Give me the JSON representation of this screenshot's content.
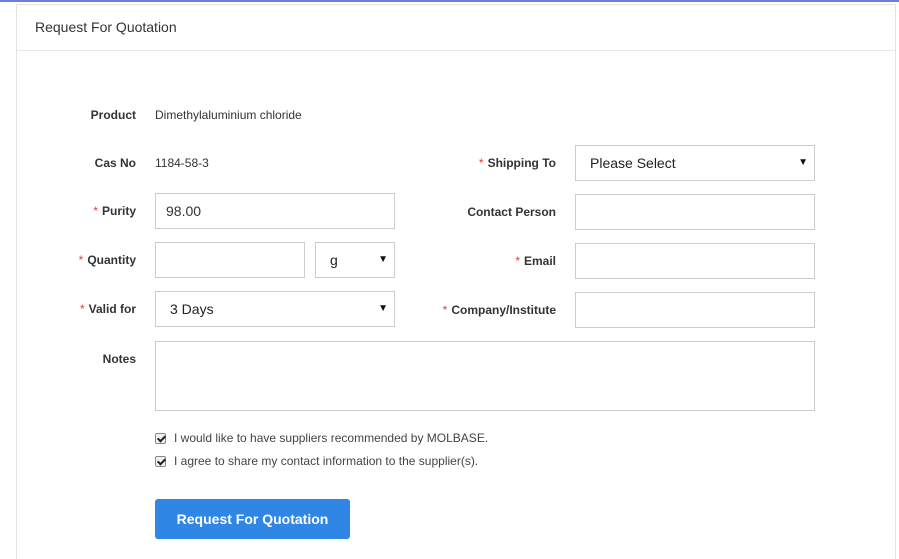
{
  "panel": {
    "title": "Request For Quotation"
  },
  "form": {
    "product": {
      "label": "Product",
      "value": "Dimethylaluminium chloride"
    },
    "cas": {
      "label": "Cas No",
      "value": "1184-58-3"
    },
    "purity": {
      "label": "Purity",
      "required": "*",
      "value": "98.00"
    },
    "quantity": {
      "label": "Quantity",
      "required": "*",
      "value": "",
      "unit": "g"
    },
    "valid_for": {
      "label": "Valid for",
      "required": "*",
      "value": "3 Days"
    },
    "notes": {
      "label": "Notes",
      "value": ""
    },
    "shipping_to": {
      "label": "Shipping To",
      "required": "*",
      "value": "Please Select"
    },
    "contact_person": {
      "label": "Contact Person",
      "value": ""
    },
    "email": {
      "label": "Email",
      "required": "*",
      "value": ""
    },
    "company": {
      "label": "Company/Institute",
      "required": "*",
      "value": ""
    }
  },
  "checkboxes": [
    {
      "label": "I would like to have suppliers recommended by MOLBASE.",
      "checked": true
    },
    {
      "label": "I agree to share my contact information to the supplier(s).",
      "checked": true
    }
  ],
  "submit": {
    "label": "Request For Quotation"
  },
  "colors": {
    "accent": "#2f86e4",
    "required": "#e4393c"
  }
}
